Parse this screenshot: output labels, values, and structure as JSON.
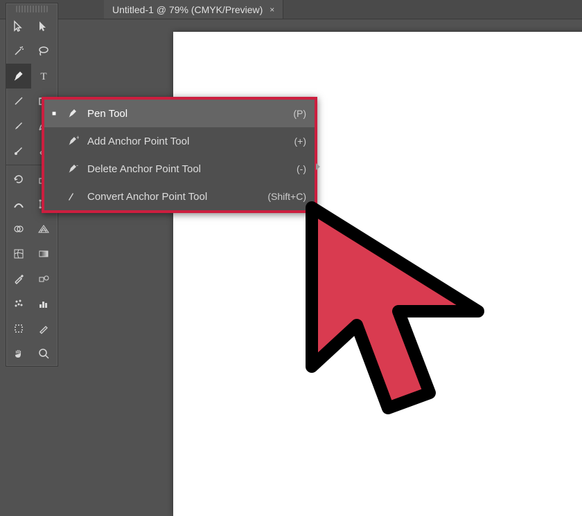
{
  "tab": {
    "title": "Untitled-1 @ 79% (CMYK/Preview)",
    "close": "×"
  },
  "flyout": {
    "items": [
      {
        "label": "Pen Tool",
        "shortcut": "(P)",
        "selected": true,
        "icon": "pen"
      },
      {
        "label": "Add Anchor Point Tool",
        "shortcut": "(+)",
        "selected": false,
        "icon": "pen-plus"
      },
      {
        "label": "Delete Anchor Point Tool",
        "shortcut": "(-)",
        "selected": false,
        "icon": "pen-minus"
      },
      {
        "label": "Convert Anchor Point Tool",
        "shortcut": "(Shift+C)",
        "selected": false,
        "icon": "convert"
      }
    ]
  },
  "colors": {
    "highlight": "#cc1e3f",
    "cursor_fill": "#d93b50",
    "cursor_stroke": "#000000"
  }
}
